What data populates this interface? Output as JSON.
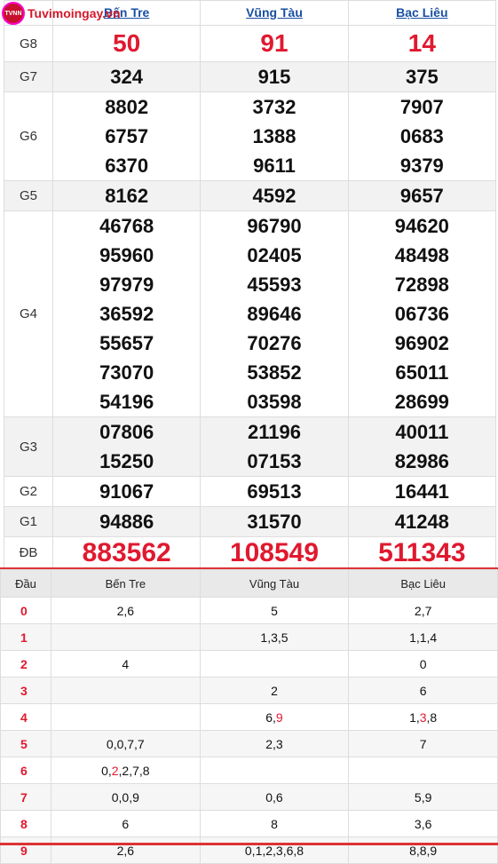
{
  "logo": {
    "text": "Tuvimoingay.vn",
    "badge": "TVNN"
  },
  "provinces": [
    "Bến Tre",
    "Vũng Tàu",
    "Bạc Liêu"
  ],
  "prizes": {
    "G8": {
      "label": "G8",
      "values": [
        "50",
        "91",
        "14"
      ]
    },
    "G7": {
      "label": "G7",
      "values": [
        "324",
        "915",
        "375"
      ]
    },
    "G6": {
      "label": "G6",
      "values": [
        [
          "8802",
          "6757",
          "6370"
        ],
        [
          "3732",
          "1388",
          "9611"
        ],
        [
          "7907",
          "0683",
          "9379"
        ]
      ]
    },
    "G5": {
      "label": "G5",
      "values": [
        "8162",
        "4592",
        "9657"
      ]
    },
    "G4": {
      "label": "G4",
      "values": [
        [
          "46768",
          "95960",
          "97979",
          "36592",
          "55657",
          "73070",
          "54196"
        ],
        [
          "96790",
          "02405",
          "45593",
          "89646",
          "70276",
          "53852",
          "03598"
        ],
        [
          "94620",
          "48498",
          "72898",
          "06736",
          "96902",
          "65011",
          "28699"
        ]
      ]
    },
    "G3": {
      "label": "G3",
      "values": [
        [
          "07806",
          "15250"
        ],
        [
          "21196",
          "07153"
        ],
        [
          "40011",
          "82986"
        ]
      ]
    },
    "G2": {
      "label": "G2",
      "values": [
        "91067",
        "69513",
        "16441"
      ]
    },
    "G1": {
      "label": "G1",
      "values": [
        "94886",
        "31570",
        "41248"
      ]
    },
    "DB": {
      "label": "ĐB",
      "values": [
        "883562",
        "108549",
        "511343"
      ]
    }
  },
  "loto": {
    "headers": [
      "Đầu",
      "Bến Tre",
      "Vũng Tàu",
      "Bạc Liêu"
    ],
    "rows": [
      {
        "dau": "0",
        "a": [
          "2,6"
        ],
        "b": [
          "5"
        ],
        "c": [
          "2,7"
        ]
      },
      {
        "dau": "1",
        "a": [
          ""
        ],
        "b": [
          "1,3,5"
        ],
        "c": [
          "1,1,4"
        ]
      },
      {
        "dau": "2",
        "a": [
          "4"
        ],
        "b": [
          ""
        ],
        "c": [
          "0"
        ]
      },
      {
        "dau": "3",
        "a": [
          ""
        ],
        "b": [
          "2"
        ],
        "c": [
          "6"
        ]
      },
      {
        "dau": "4",
        "a": [
          ""
        ],
        "b": [
          "6,",
          "9"
        ],
        "c": [
          "1,",
          "3",
          ",8"
        ]
      },
      {
        "dau": "5",
        "a": [
          "0,0,7,7"
        ],
        "b": [
          "2,3"
        ],
        "c": [
          "7"
        ]
      },
      {
        "dau": "6",
        "a": [
          "0,",
          "2",
          ",2,7,8"
        ],
        "b": [
          ""
        ],
        "c": [
          ""
        ]
      },
      {
        "dau": "7",
        "a": [
          "0,0,9"
        ],
        "b": [
          "0,6"
        ],
        "c": [
          "5,9"
        ]
      },
      {
        "dau": "8",
        "a": [
          "6"
        ],
        "b": [
          "8"
        ],
        "c": [
          "3,6"
        ]
      },
      {
        "dau": "9",
        "a": [
          "2,6"
        ],
        "b": [
          "0,1,2,3,6,8"
        ],
        "c": [
          "8,8,9"
        ]
      }
    ]
  },
  "colors": {
    "accent": "#e0192f",
    "link": "#1a4fa3",
    "border": "#dddddd"
  }
}
